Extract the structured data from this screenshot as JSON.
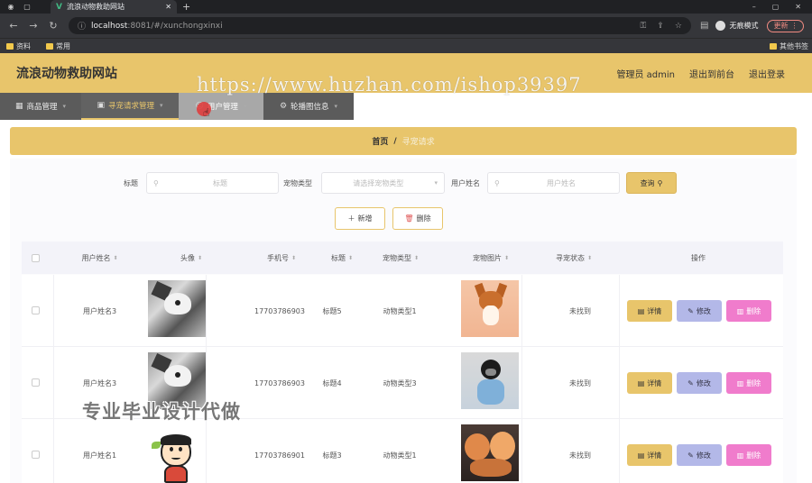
{
  "browser": {
    "tab_title": "流浪动物救助网站",
    "url_host": "localhost",
    "url_path": ":8081/#/xunchongxinxi",
    "profile_label": "无痕模式",
    "update_label": "更新",
    "bookmarks": [
      "资料",
      "常用"
    ],
    "bookmarks_right": "其他书签"
  },
  "header": {
    "site_title": "流浪动物救助网站",
    "admin_label": "管理员 admin",
    "back_label": "退出到前台",
    "logout_label": "退出登录"
  },
  "menu": {
    "items": [
      {
        "label": "商品管理"
      },
      {
        "label": "寻宠请求管理"
      },
      {
        "label": "用户管理"
      },
      {
        "label": "轮播图信息"
      }
    ]
  },
  "watermark": "https://www.huzhan.com/ishop39397",
  "breadcrumb": {
    "home": "首页",
    "separator": "/",
    "current": "寻宠请求"
  },
  "search": {
    "title_label": "标题",
    "title_placeholder": "标题",
    "type_label": "宠物类型",
    "type_placeholder": "请选择宠物类型",
    "name_label": "用户姓名",
    "name_placeholder": "用户姓名",
    "query_label": "查询"
  },
  "actions": {
    "add_label": "新增",
    "delete_label": "删除"
  },
  "table": {
    "headers": {
      "username": "用户姓名",
      "avatar": "头像",
      "phone": "手机号",
      "title": "标题",
      "pet_type": "宠物类型",
      "pet_image": "宠物图片",
      "status": "寻宠状态",
      "ops": "操作"
    },
    "row_buttons": {
      "detail": "详情",
      "edit": "修改",
      "remove": "删除"
    },
    "rows": [
      {
        "username": "用户姓名3",
        "phone": "17703786903",
        "title": "标题5",
        "pet_type": "动物类型1",
        "status": "未找到"
      },
      {
        "username": "用户姓名3",
        "phone": "17703786903",
        "title": "标题4",
        "pet_type": "动物类型3",
        "status": "未找到"
      },
      {
        "username": "用户姓名1",
        "phone": "17703786901",
        "title": "标题3",
        "pet_type": "动物类型1",
        "status": "未找到"
      }
    ]
  },
  "promo_text": "专业毕业设计代做",
  "colors": {
    "brand": "#e8c56b",
    "edit": "#b3b8e8",
    "remove": "#f07ccc"
  }
}
